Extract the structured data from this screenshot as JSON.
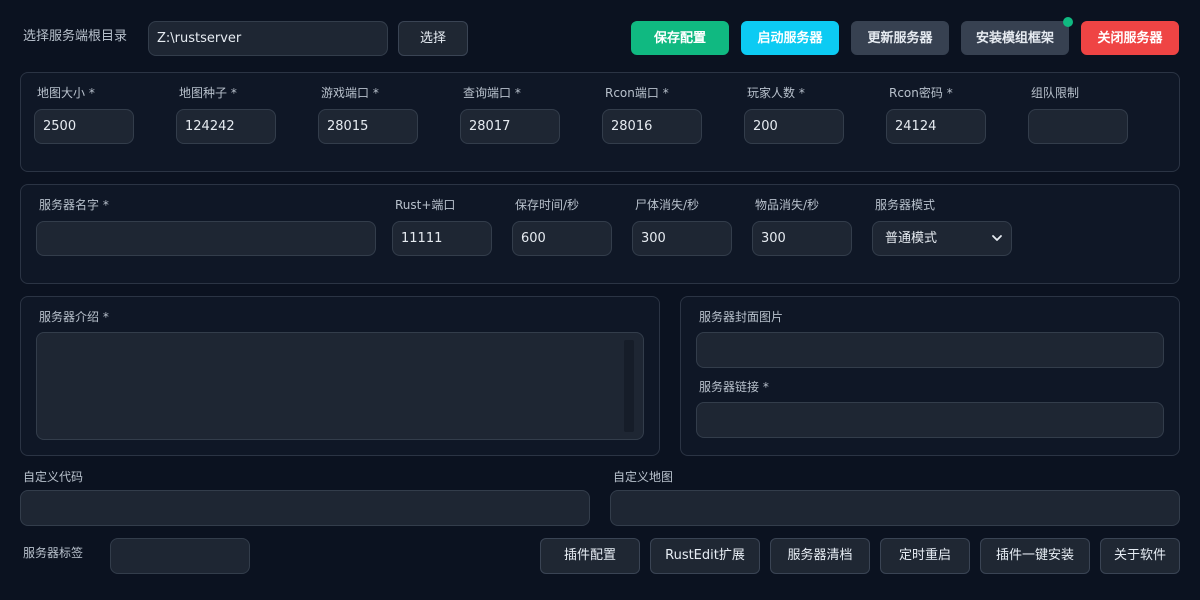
{
  "header": {
    "root_label": "选择服务端根目录",
    "root_path": "Z:\\rustserver",
    "choose_btn": "选择",
    "save_config": "保存配置",
    "start_server": "启动服务器",
    "update_server": "更新服务器",
    "install_mod_framework": "安装模组框架",
    "stop_server": "关闭服务器",
    "status_color": "#10b981"
  },
  "basic": {
    "fields": [
      {
        "label": "地图大小 *",
        "value": "2500"
      },
      {
        "label": "地图种子 *",
        "value": "124242"
      },
      {
        "label": "游戏端口 *",
        "value": "28015"
      },
      {
        "label": "查询端口 *",
        "value": "28017"
      },
      {
        "label": "Rcon端口 *",
        "value": "28016"
      },
      {
        "label": "玩家人数 *",
        "value": "200"
      },
      {
        "label": "Rcon密码 *",
        "value": "24124"
      },
      {
        "label": "组队限制",
        "value": ""
      }
    ]
  },
  "server": {
    "name_label": "服务器名字 *",
    "name_value": "",
    "rustplus_label": "Rust+端口",
    "rustplus_value": "11111",
    "save_time_label": "保存时间/秒",
    "save_time_value": "600",
    "corpse_label": "尸体消失/秒",
    "corpse_value": "300",
    "item_label": "物品消失/秒",
    "item_value": "300",
    "mode_label": "服务器模式",
    "mode_value": "普通模式"
  },
  "description": {
    "label": "服务器介绍 *",
    "value": ""
  },
  "media": {
    "cover_label": "服务器封面图片",
    "cover_value": "",
    "link_label": "服务器链接 *",
    "link_value": ""
  },
  "custom": {
    "code_label": "自定义代码",
    "code_value": "",
    "map_label": "自定义地图",
    "map_value": ""
  },
  "footer": {
    "tags_label": "服务器标签",
    "tags_value": "",
    "plugin_config": "插件配置",
    "rustedit_ext": "RustEdit扩展",
    "server_wipe": "服务器清档",
    "scheduled_restart": "定时重启",
    "plugin_install": "插件一键安装",
    "about": "关于软件"
  },
  "colors": {
    "background": "#0b1220",
    "panel": "#0f1726",
    "input": "#1e2633",
    "green": "#10b981",
    "cyan": "#0ccbf3",
    "red": "#ef4444"
  }
}
